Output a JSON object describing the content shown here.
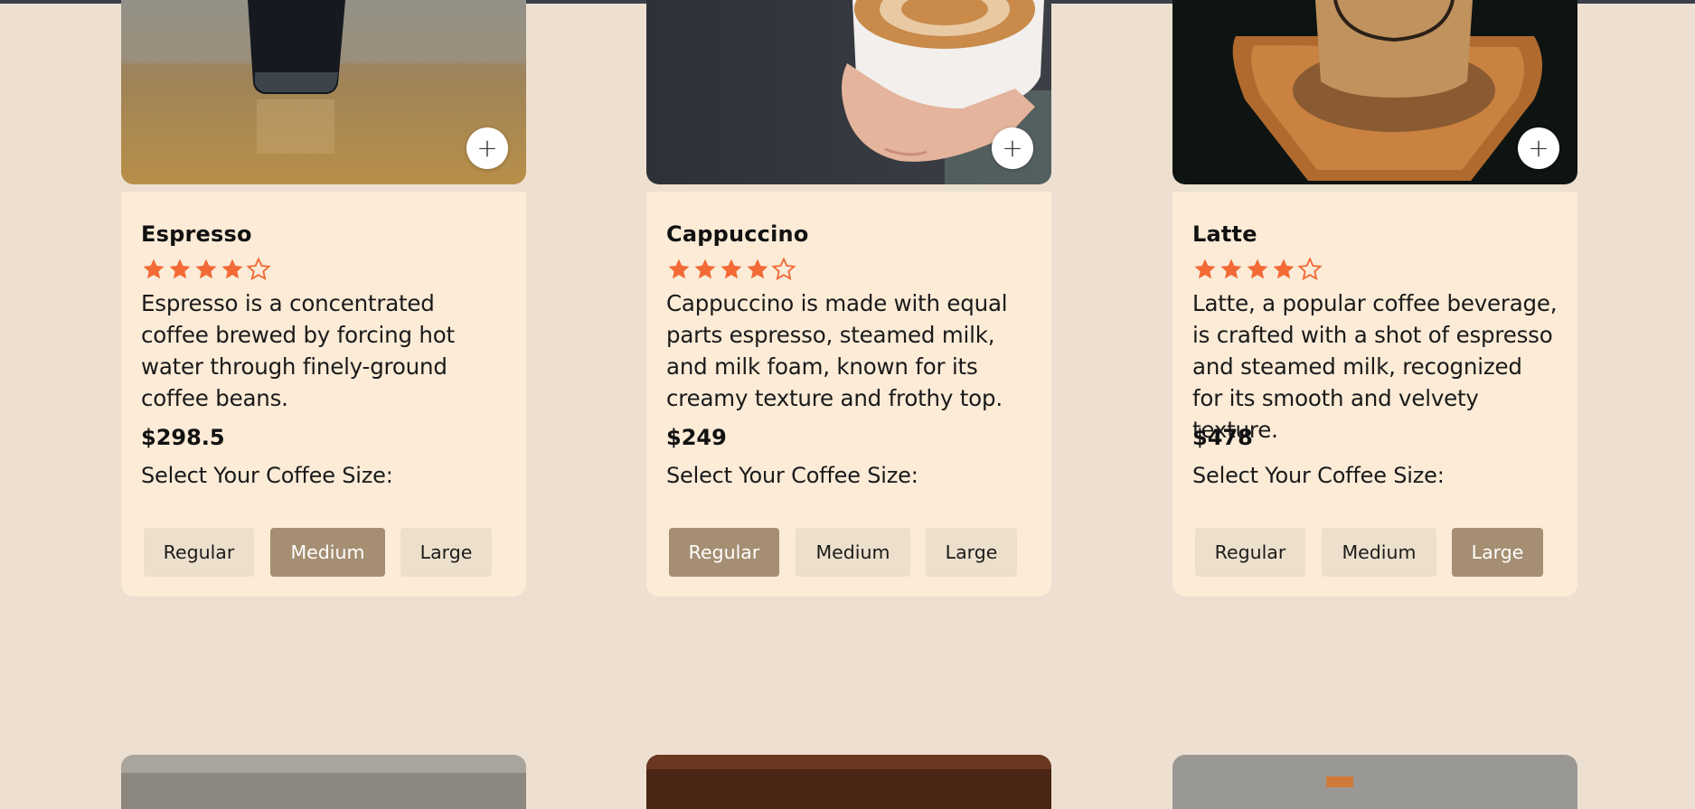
{
  "colors": {
    "page_bg": "#ede0d0",
    "card_bg": "#fbebd7",
    "star": "#f26a36",
    "size_active": "#a58e72",
    "size_inactive": "#ecdfcc"
  },
  "size_options": [
    "Regular",
    "Medium",
    "Large"
  ],
  "products": [
    {
      "name": "Espresso",
      "rating": 4,
      "rating_max": 5,
      "description": "Espresso is a concentrated coffee brewed by forcing hot water through finely-ground coffee beans.",
      "price": "$298.5",
      "size_label": "Select Your Coffee Size:",
      "selected_size": "Medium",
      "add_icon": "plus-icon",
      "image": "espresso-glass-photo"
    },
    {
      "name": "Cappuccino",
      "rating": 4,
      "rating_max": 5,
      "description": "Cappuccino is made with equal parts espresso, steamed milk, and milk foam, known for its creamy texture and frothy top.",
      "price": "$249",
      "size_label": "Select Your Coffee Size:",
      "selected_size": "Regular",
      "add_icon": "plus-icon",
      "image": "cappuccino-cup-photo"
    },
    {
      "name": "Latte",
      "rating": 4,
      "rating_max": 5,
      "description": "Latte, a popular coffee beverage, is crafted with a shot of espresso and steamed milk, recognized for its smooth and velvety texture.",
      "price": "$478",
      "size_label": "Select Your Coffee Size:",
      "selected_size": "Large",
      "add_icon": "plus-icon",
      "image": "latte-cup-photo"
    }
  ],
  "add_button_symbol": "+"
}
